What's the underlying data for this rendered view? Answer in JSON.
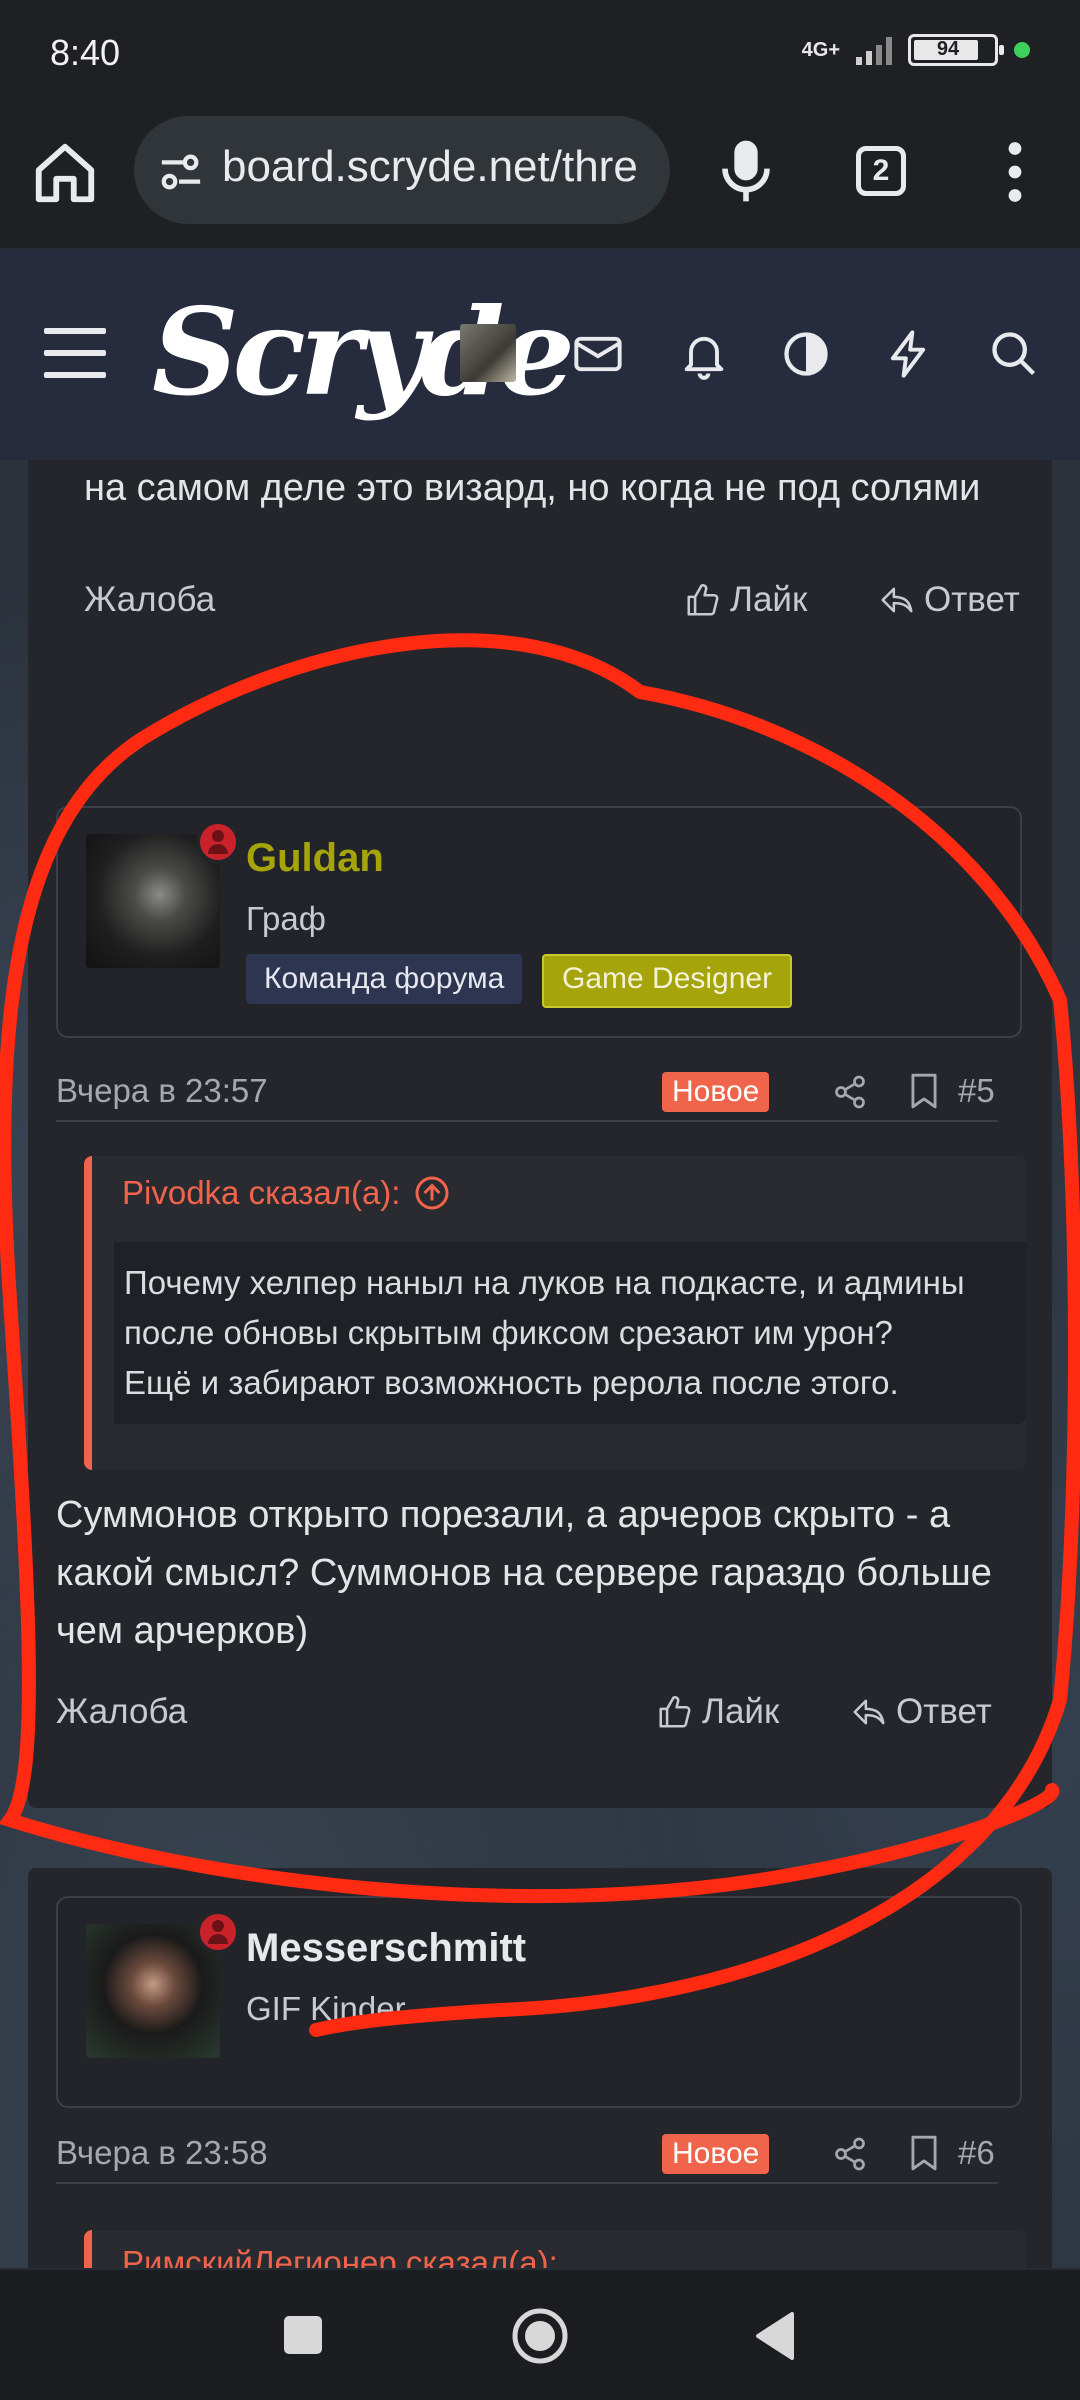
{
  "status": {
    "time": "8:40",
    "network": "4G+",
    "battery": "94"
  },
  "browser": {
    "url": "board.scryde.net/thre",
    "tab_count": "2"
  },
  "site": {
    "logo": "Scryde"
  },
  "prev_post": {
    "text": "на самом деле это визард, но когда не под солями",
    "report": "Жалоба",
    "like": "Лайк",
    "reply": "Ответ"
  },
  "post5": {
    "author": "Guldan",
    "author_color": "#a5a40a",
    "user_title": "Граф",
    "badges": [
      "Команда форума",
      "Game Designer"
    ],
    "date": "Вчера в 23:57",
    "new_label": "Новое",
    "number": "#5",
    "quote": {
      "author": "Pivodka сказал(а):",
      "text": "Почему хелпер наныл на луков на подкасте, и админы после обновы скрытым фиксом срезают им урон?\nЕщё и забирают возможность рерола после этого."
    },
    "text": "Суммонов открыто порезали, а арчеров скрыто - а какой смысл? Суммонов на сервере гараздо больше чем арчерков)",
    "report": "Жалоба",
    "like": "Лайк",
    "reply": "Ответ"
  },
  "post6": {
    "author": "Messerschmitt",
    "user_title": "GIF Kinder",
    "date": "Вчера в 23:58",
    "new_label": "Новое",
    "number": "#6",
    "quote_author": "РимскийЛегионер сказал(а):"
  },
  "colors": {
    "accent": "#f0644c",
    "annotation": "#ff2a12"
  }
}
